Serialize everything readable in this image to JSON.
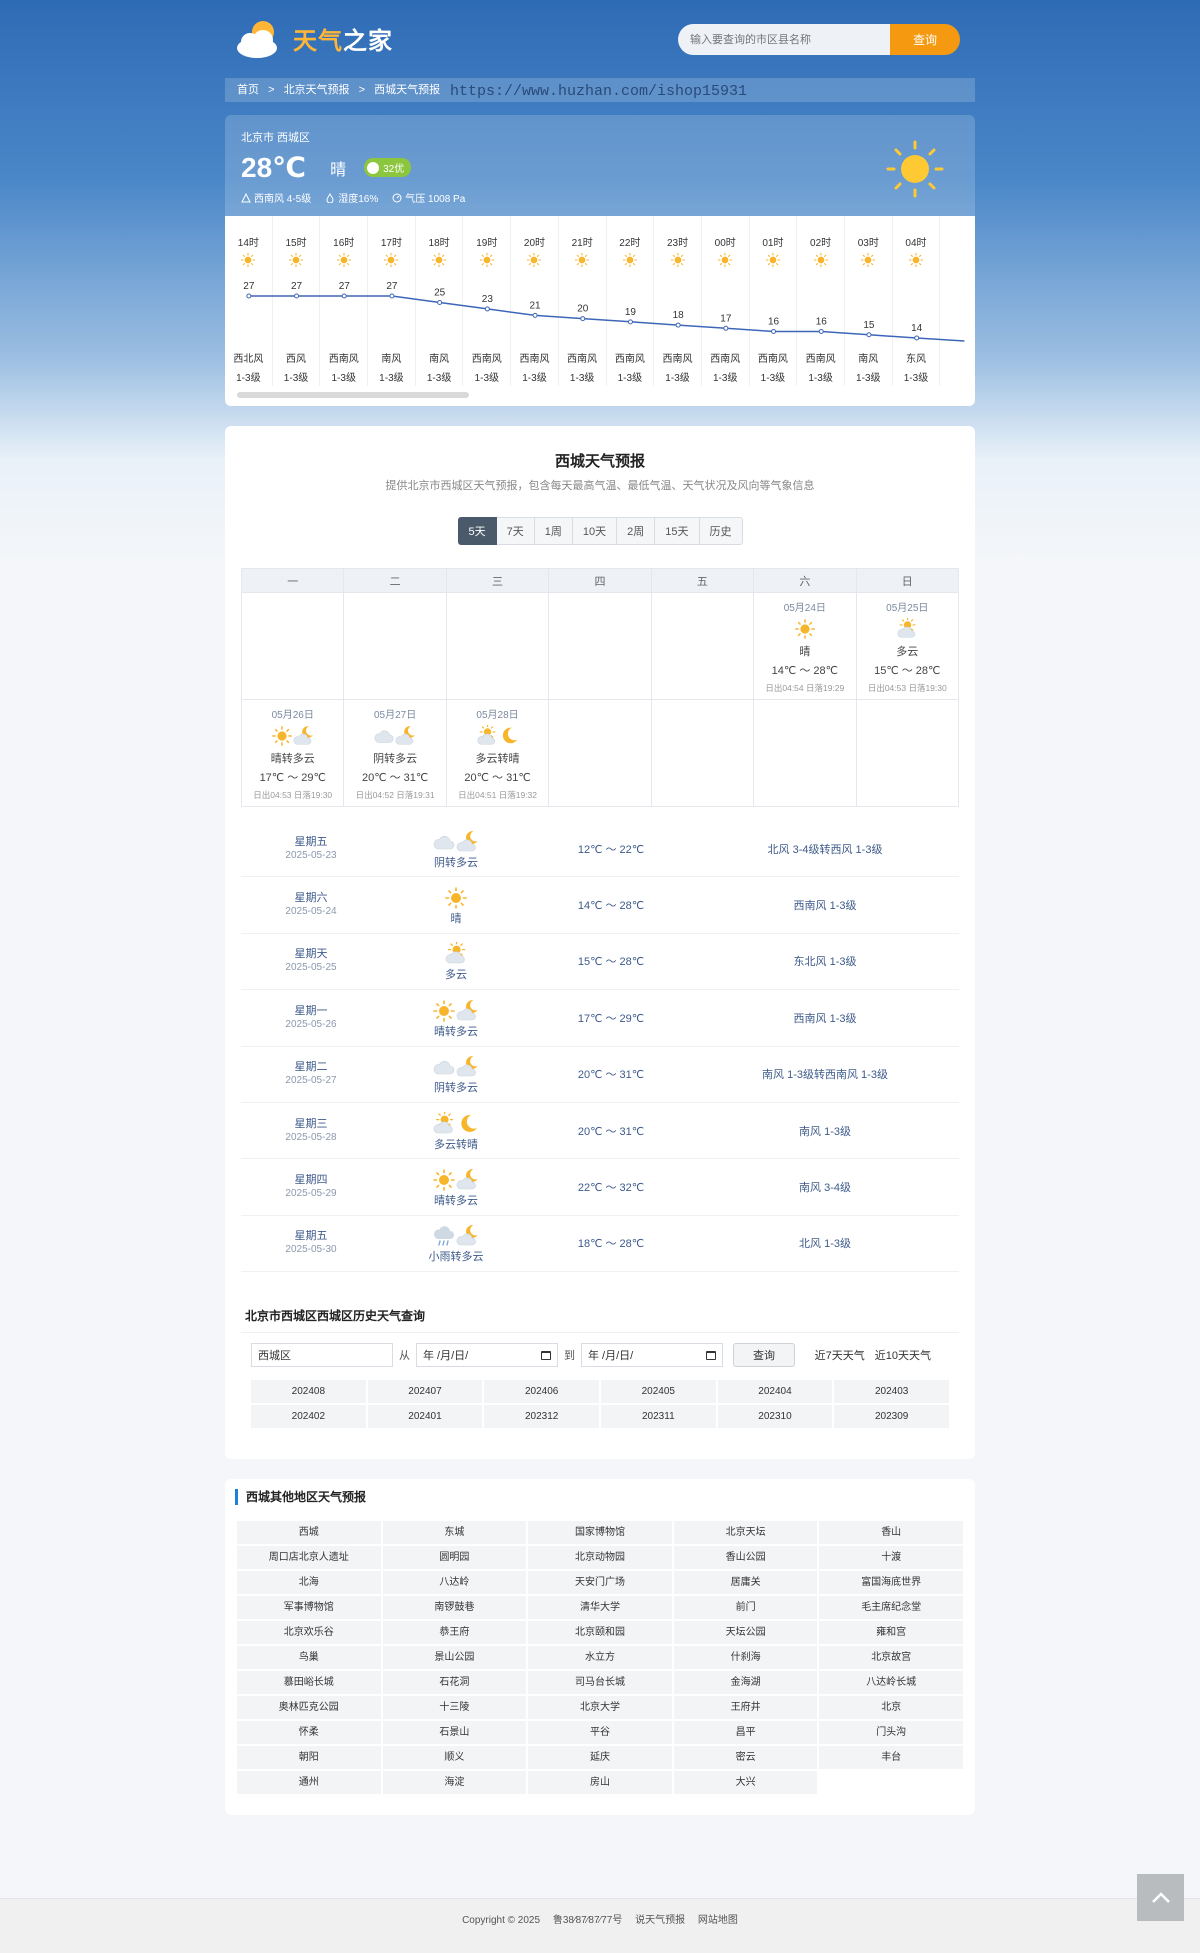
{
  "logo": {
    "part1": "天气",
    "part2": "之家"
  },
  "search": {
    "placeholder": "输入要查询的市区县名称",
    "button": "查询"
  },
  "breadcrumb": [
    "首页",
    ">",
    "北京天气预报",
    ">",
    "西城天气预报"
  ],
  "watermark": "https://www.huzhan.com/ishop15931",
  "current": {
    "location": "北京市 西城区",
    "temp": "28℃",
    "condition": "晴",
    "aqi": "32优",
    "wind": "西南风 4-5级",
    "humidity": "湿度16%",
    "pressure": "气压 1008 Pa",
    "aqi_color": "#8cc63f"
  },
  "hourly": [
    {
      "time": "14时",
      "icon": "sun-icon",
      "temp": 27,
      "wind": "西北风",
      "level": "1-3级"
    },
    {
      "time": "15时",
      "icon": "sun-icon",
      "temp": 27,
      "wind": "西风",
      "level": "1-3级"
    },
    {
      "time": "16时",
      "icon": "sun-icon",
      "temp": 27,
      "wind": "西南风",
      "level": "1-3级"
    },
    {
      "time": "17时",
      "icon": "sun-icon",
      "temp": 27,
      "wind": "南风",
      "level": "1-3级"
    },
    {
      "time": "18时",
      "icon": "sun-icon",
      "temp": 25,
      "wind": "南风",
      "level": "1-3级"
    },
    {
      "time": "19时",
      "icon": "sun-icon",
      "temp": 23,
      "wind": "西南风",
      "level": "1-3级"
    },
    {
      "time": "20时",
      "icon": "sun-icon",
      "temp": 21,
      "wind": "西南风",
      "level": "1-3级"
    },
    {
      "time": "21时",
      "icon": "sun-icon",
      "temp": 20,
      "wind": "西南风",
      "level": "1-3级"
    },
    {
      "time": "22时",
      "icon": "sun-icon",
      "temp": 19,
      "wind": "西南风",
      "level": "1-3级"
    },
    {
      "time": "23时",
      "icon": "sun-icon",
      "temp": 18,
      "wind": "西南风",
      "level": "1-3级"
    },
    {
      "time": "00时",
      "icon": "sun-icon",
      "temp": 17,
      "wind": "西南风",
      "level": "1-3级"
    },
    {
      "time": "01时",
      "icon": "sun-icon",
      "temp": 16,
      "wind": "西南风",
      "level": "1-3级"
    },
    {
      "time": "02时",
      "icon": "sun-icon",
      "temp": 16,
      "wind": "西南风",
      "level": "1-3级"
    },
    {
      "time": "03时",
      "icon": "sun-icon",
      "temp": 15,
      "wind": "南风",
      "level": "1-3级"
    },
    {
      "time": "04时",
      "icon": "sun-icon",
      "temp": 14,
      "wind": "东风",
      "level": "1-3级"
    }
  ],
  "forecast": {
    "title": "西城天气预报",
    "subtitle": "提供北京市西城区天气预报，包含每天最高气温、最低气温、天气状况及风向等气象信息",
    "tabs": [
      "5天",
      "7天",
      "1周",
      "10天",
      "2周",
      "15天",
      "历史"
    ],
    "active_tab": "5天",
    "weekdays": [
      "一",
      "二",
      "三",
      "四",
      "五",
      "六",
      "日"
    ],
    "calendar": [
      [
        null,
        null,
        null,
        null,
        null,
        {
          "date": "05月24日",
          "icons": [
            "sun-icon"
          ],
          "cond": "晴",
          "temp": "14℃ ～ 28℃",
          "sun": "日出04:54 日落19:29"
        },
        {
          "date": "05月25日",
          "icons": [
            "partly-cloudy-icon"
          ],
          "cond": "多云",
          "temp": "15℃ ～ 28℃",
          "sun": "日出04:53 日落19:30"
        }
      ],
      [
        {
          "date": "05月26日",
          "icons": [
            "sun-icon",
            "cloud-moon-icon"
          ],
          "cond": "晴转多云",
          "temp": "17℃ ～ 29℃",
          "sun": "日出04:53 日落19:30"
        },
        {
          "date": "05月27日",
          "icons": [
            "cloud-icon",
            "cloud-moon-icon"
          ],
          "cond": "阴转多云",
          "temp": "20℃ ～ 31℃",
          "sun": "日出04:52 日落19:31"
        },
        {
          "date": "05月28日",
          "icons": [
            "partly-cloudy-icon",
            "moon-icon"
          ],
          "cond": "多云转晴",
          "temp": "20℃ ～ 31℃",
          "sun": "日出04:51 日落19:32"
        },
        null,
        null,
        null,
        null
      ]
    ],
    "days": [
      {
        "week": "星期五",
        "date": "2025-05-23",
        "icons": [
          "cloud-icon",
          "cloud-moon-icon"
        ],
        "cond": "阴转多云",
        "temp": "12℃ ～ 22℃",
        "wind": "北风 3-4级转西风 1-3级"
      },
      {
        "week": "星期六",
        "date": "2025-05-24",
        "icons": [
          "sun-icon"
        ],
        "cond": "晴",
        "temp": "14℃ ～ 28℃",
        "wind": "西南风 1-3级"
      },
      {
        "week": "星期天",
        "date": "2025-05-25",
        "icons": [
          "partly-cloudy-icon"
        ],
        "cond": "多云",
        "temp": "15℃ ～ 28℃",
        "wind": "东北风 1-3级"
      },
      {
        "week": "星期一",
        "date": "2025-05-26",
        "icons": [
          "sun-icon",
          "cloud-moon-icon"
        ],
        "cond": "晴转多云",
        "temp": "17℃ ～ 29℃",
        "wind": "西南风 1-3级"
      },
      {
        "week": "星期二",
        "date": "2025-05-27",
        "icons": [
          "cloud-icon",
          "cloud-moon-icon"
        ],
        "cond": "阴转多云",
        "temp": "20℃ ～ 31℃",
        "wind": "南风 1-3级转西南风 1-3级"
      },
      {
        "week": "星期三",
        "date": "2025-05-28",
        "icons": [
          "partly-cloudy-icon",
          "moon-icon"
        ],
        "cond": "多云转晴",
        "temp": "20℃ ～ 31℃",
        "wind": "南风 1-3级"
      },
      {
        "week": "星期四",
        "date": "2025-05-29",
        "icons": [
          "sun-icon",
          "cloud-moon-icon"
        ],
        "cond": "晴转多云",
        "temp": "22℃ ～ 32℃",
        "wind": "南风 3-4级"
      },
      {
        "week": "星期五",
        "date": "2025-05-30",
        "icons": [
          "rain-cloud-icon",
          "cloud-moon-icon"
        ],
        "cond": "小雨转多云",
        "temp": "18℃ ～ 28℃",
        "wind": "北风 1-3级"
      }
    ]
  },
  "history": {
    "title": "北京市西城区西城区历史天气查询",
    "area_value": "西城区",
    "from": "从",
    "to": "到",
    "date_placeholder": "年 /月/日/",
    "button": "查询",
    "link7": "近7天天气",
    "link10": "近10天天气",
    "months": [
      "202408",
      "202407",
      "202406",
      "202405",
      "202404",
      "202403",
      "202402",
      "202401",
      "202312",
      "202311",
      "202310",
      "202309"
    ]
  },
  "other": {
    "title": "西城其他地区天气预报",
    "places": [
      "西城",
      "东城",
      "国家博物馆",
      "北京天坛",
      "香山",
      "周口店北京人遗址",
      "圆明园",
      "北京动物园",
      "香山公园",
      "十渡",
      "北海",
      "八达岭",
      "天安门广场",
      "居庸关",
      "富国海底世界",
      "军事博物馆",
      "南锣鼓巷",
      "清华大学",
      "前门",
      "毛主席纪念堂",
      "北京欢乐谷",
      "恭王府",
      "北京颐和园",
      "天坛公园",
      "雍和宫",
      "鸟巢",
      "景山公园",
      "水立方",
      "什刹海",
      "北京故宫",
      "慕田峪长城",
      "石花洞",
      "司马台长城",
      "金海湖",
      "八达岭长城",
      "奥林匹克公园",
      "十三陵",
      "北京大学",
      "王府井",
      "北京",
      "怀柔",
      "石景山",
      "平谷",
      "昌平",
      "门头沟",
      "朝阳",
      "顺义",
      "延庆",
      "密云",
      "丰台",
      "通州",
      "海淀",
      "房山",
      "大兴"
    ]
  },
  "footer": {
    "copyright": "Copyright © 2025",
    "icp": "鲁38⁄​87⁄​87⁄​77号",
    "link1": "说天气预报",
    "link2": "网站地图"
  },
  "colors": {
    "accent": "#f59a10",
    "line": "#3e66b8",
    "sun": "#f7b52c"
  }
}
